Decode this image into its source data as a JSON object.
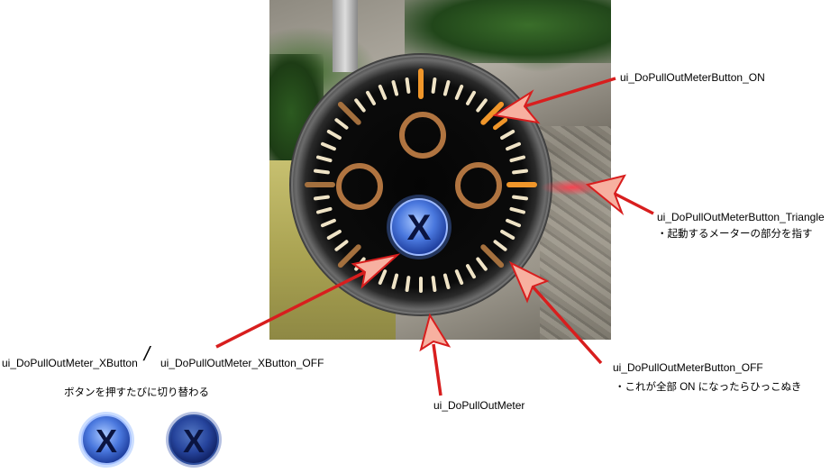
{
  "labels": {
    "button_on": "ui_DoPullOutMeterButton_ON",
    "button_triangle": "ui_DoPullOutMeterButton_Triangle",
    "triangle_note": "・起動するメーターの部分を指す",
    "button_off": "ui_DoPullOutMeterButton_OFF",
    "off_note": "・これが全部 ON になったらひっこぬき",
    "meter": "ui_DoPullOutMeter",
    "xbutton": "ui_DoPullOutMeter_XButton",
    "slash": "/",
    "xbutton_off": "ui_DoPullOutMeter_XButton_OFF",
    "xbutton_note": "ボタンを押すたびに切り替わる",
    "x_glyph": "X"
  },
  "colors": {
    "arrow": "#d81e1e",
    "arrow_fill": "#f7b0a0",
    "tick_on": "#f0962a",
    "tick_off": "#efe3c6",
    "tick_dim": "#a4703e",
    "ring": "#b07440",
    "xbutton_on": "#3f6fd6",
    "xbutton_off": "#23409a"
  }
}
